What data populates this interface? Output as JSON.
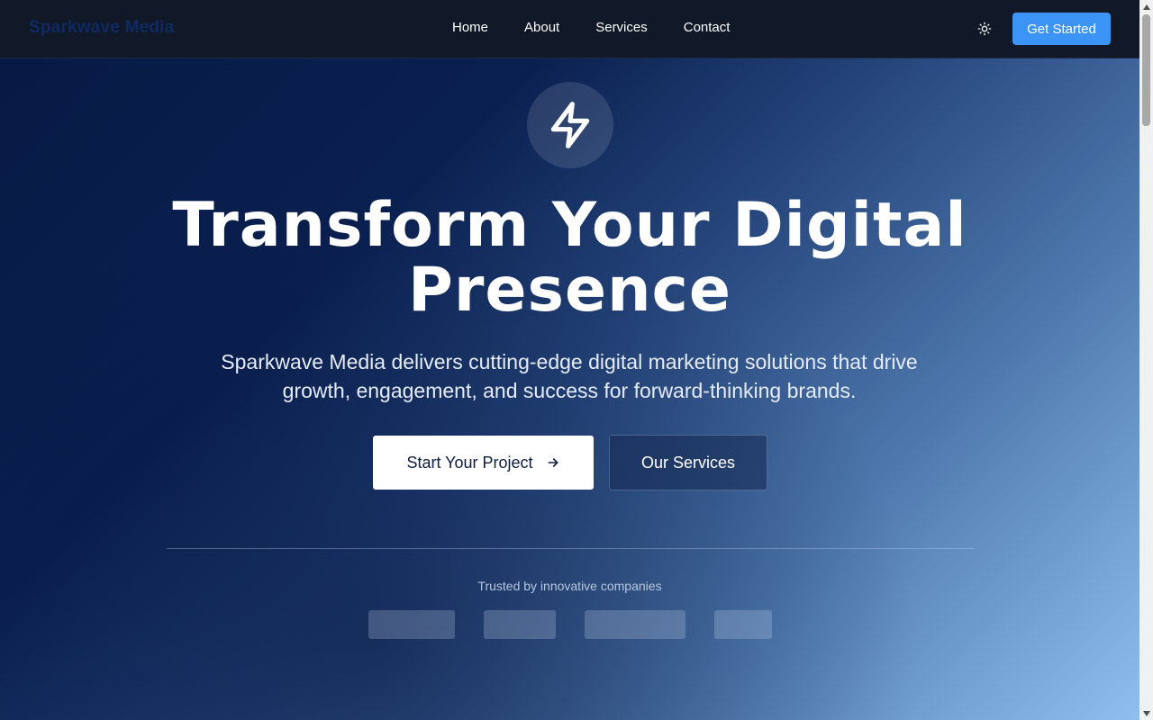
{
  "navbar": {
    "brand": "Sparkwave Media",
    "links": [
      "Home",
      "About",
      "Services",
      "Contact"
    ],
    "theme_icon": "sun-icon",
    "cta_label": "Get Started"
  },
  "hero": {
    "icon": "lightning-icon",
    "title_line1": "Transform Your Digital",
    "title_line2": "Presence",
    "subtitle": "Sparkwave Media delivers cutting-edge digital marketing solutions that drive growth, engagement, and success for forward-thinking brands.",
    "primary_button": "Start Your Project",
    "primary_button_icon": "arrow-right-icon",
    "secondary_button": "Our Services",
    "trusted_label": "Trusted by innovative companies",
    "logo_count": 4
  },
  "colors": {
    "accent": "#3b94f6",
    "navbar_bg": "#111827",
    "brand_text": "#0f2a63"
  }
}
